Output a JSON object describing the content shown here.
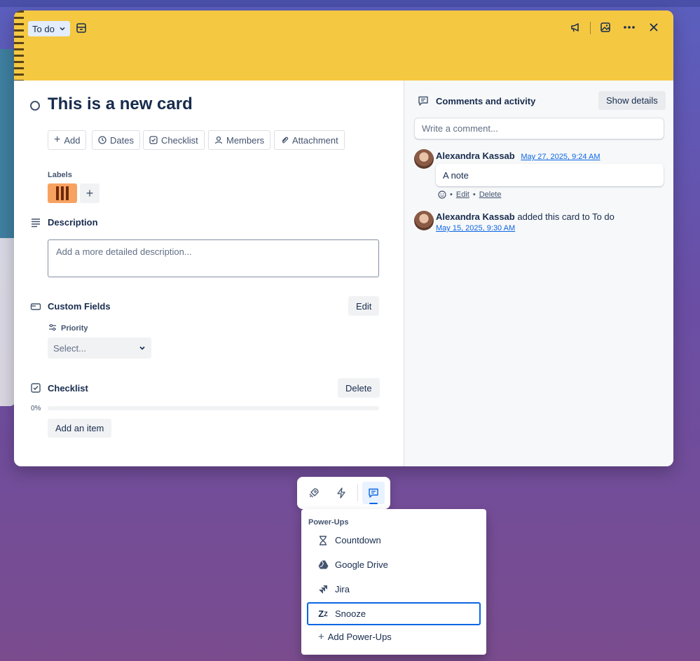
{
  "header": {
    "list_name": "To do"
  },
  "card": {
    "title": "This is a new card",
    "actions": [
      "Add",
      "Dates",
      "Checklist",
      "Members",
      "Attachment"
    ],
    "labels_heading": "Labels",
    "label_color": "#f8a261",
    "description": {
      "heading": "Description",
      "placeholder": "Add a more detailed description..."
    },
    "custom_fields": {
      "heading": "Custom Fields",
      "edit_label": "Edit",
      "priority_label": "Priority",
      "priority_value": "Select..."
    },
    "checklist": {
      "heading": "Checklist",
      "delete_label": "Delete",
      "progress_text": "0%",
      "progress": 0,
      "add_item_label": "Add an item"
    }
  },
  "activity": {
    "heading": "Comments and activity",
    "show_details_label": "Show details",
    "comment_placeholder": "Write a comment...",
    "comment": {
      "author": "Alexandra Kassab",
      "timestamp": "May 27, 2025, 9:24 AM",
      "text": "A note",
      "edit_label": "Edit",
      "delete_label": "Delete",
      "separator": "•"
    },
    "event": {
      "author": "Alexandra Kassab",
      "text": "added this card to To do",
      "timestamp": "May 15, 2025, 9:30 AM"
    }
  },
  "toolbar": {
    "icons": [
      "rocket-icon",
      "lightning-icon",
      "comment-icon"
    ],
    "active": "comment-icon"
  },
  "powerups": {
    "title": "Power-Ups",
    "items": [
      {
        "label": "Countdown",
        "icon": "hourglass-icon"
      },
      {
        "label": "Google Drive",
        "icon": "google-drive-icon"
      },
      {
        "label": "Jira",
        "icon": "jira-icon"
      },
      {
        "label": "Snooze",
        "icon": "snooze-icon"
      }
    ],
    "add_label": "Add Power-Ups",
    "accent": "#0c66e4"
  }
}
